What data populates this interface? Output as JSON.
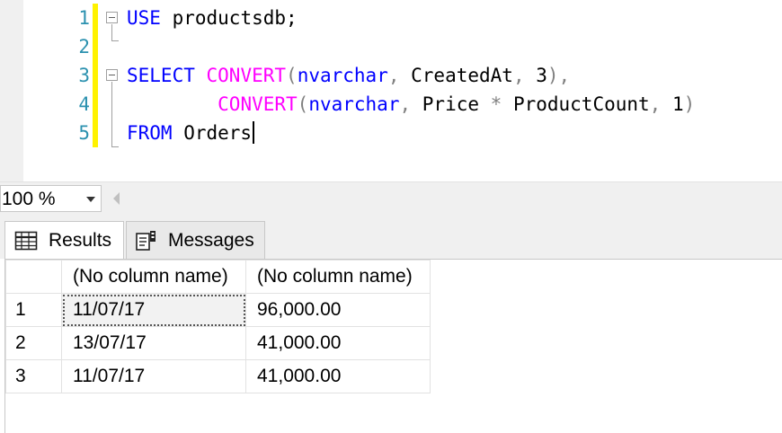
{
  "editor": {
    "lines": [
      {
        "num": "1",
        "tokens": [
          {
            "t": "USE",
            "c": "kw"
          },
          {
            "t": " productsdb;",
            "c": ""
          }
        ]
      },
      {
        "num": "2",
        "tokens": []
      },
      {
        "num": "3",
        "tokens": [
          {
            "t": "SELECT",
            "c": "kw"
          },
          {
            "t": " ",
            "c": ""
          },
          {
            "t": "CONVERT",
            "c": "fn"
          },
          {
            "t": "(",
            "c": "op"
          },
          {
            "t": "nvarchar",
            "c": "kw"
          },
          {
            "t": ", ",
            "c": "op"
          },
          {
            "t": "CreatedAt",
            "c": ""
          },
          {
            "t": ", ",
            "c": "op"
          },
          {
            "t": "3",
            "c": ""
          },
          {
            "t": "),",
            "c": "op"
          }
        ]
      },
      {
        "num": "4",
        "tokens": [
          {
            "t": "        ",
            "c": ""
          },
          {
            "t": "CONVERT",
            "c": "fn"
          },
          {
            "t": "(",
            "c": "op"
          },
          {
            "t": "nvarchar",
            "c": "kw"
          },
          {
            "t": ", ",
            "c": "op"
          },
          {
            "t": "Price",
            "c": ""
          },
          {
            "t": " * ",
            "c": "op"
          },
          {
            "t": "ProductCount",
            "c": ""
          },
          {
            "t": ", ",
            "c": "op"
          },
          {
            "t": "1",
            "c": ""
          },
          {
            "t": ")",
            "c": "op"
          }
        ]
      },
      {
        "num": "5",
        "tokens": [
          {
            "t": "FROM",
            "c": "kw"
          },
          {
            "t": " Orders",
            "c": ""
          }
        ]
      }
    ]
  },
  "zoom": {
    "value": "100 %"
  },
  "tabs": {
    "results": "Results",
    "messages": "Messages"
  },
  "grid": {
    "headers": [
      "",
      "(No column name)",
      "(No column name)"
    ],
    "rows": [
      [
        "1",
        "11/07/17",
        "96,000.00"
      ],
      [
        "2",
        "13/07/17",
        "41,000.00"
      ],
      [
        "3",
        "11/07/17",
        "41,000.00"
      ]
    ]
  },
  "colors": {
    "keyword": "#0000ff",
    "function": "#ff00ff",
    "operator": "#808080",
    "line_number": "#2b91af",
    "modified_bar": "#fff200"
  }
}
